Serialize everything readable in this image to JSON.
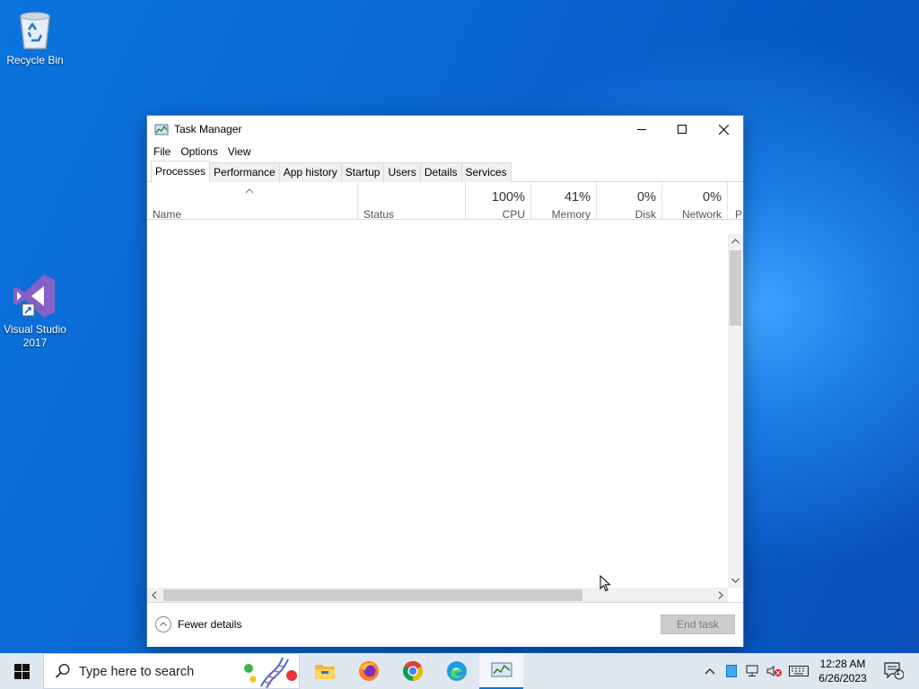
{
  "desktop": {
    "icons": [
      {
        "label": "Recycle Bin"
      },
      {
        "label": "Visual Studio 2017"
      }
    ]
  },
  "window": {
    "title": "Task Manager",
    "menu": [
      "File",
      "Options",
      "View"
    ],
    "tabs": [
      "Processes",
      "Performance",
      "App history",
      "Startup",
      "Users",
      "Details",
      "Services"
    ],
    "active_tab": "Processes",
    "columns": {
      "name": "Name",
      "status": "Status",
      "cpu": {
        "pct": "100%",
        "label": "CPU"
      },
      "memory": {
        "pct": "41%",
        "label": "Memory"
      },
      "disk": {
        "pct": "0%",
        "label": "Disk"
      },
      "network": {
        "pct": "0%",
        "label": "Network"
      },
      "power": {
        "label": "P"
      }
    },
    "footer": {
      "fewer_details": "Fewer details",
      "end_task": "End task"
    }
  },
  "taskbar": {
    "search_placeholder": "Type here to search",
    "time": "12:28 AM",
    "date": "6/26/2023",
    "notification_count": "1"
  },
  "colors": {
    "accent": "#0078d7",
    "vs_purple": "#8661c5"
  }
}
